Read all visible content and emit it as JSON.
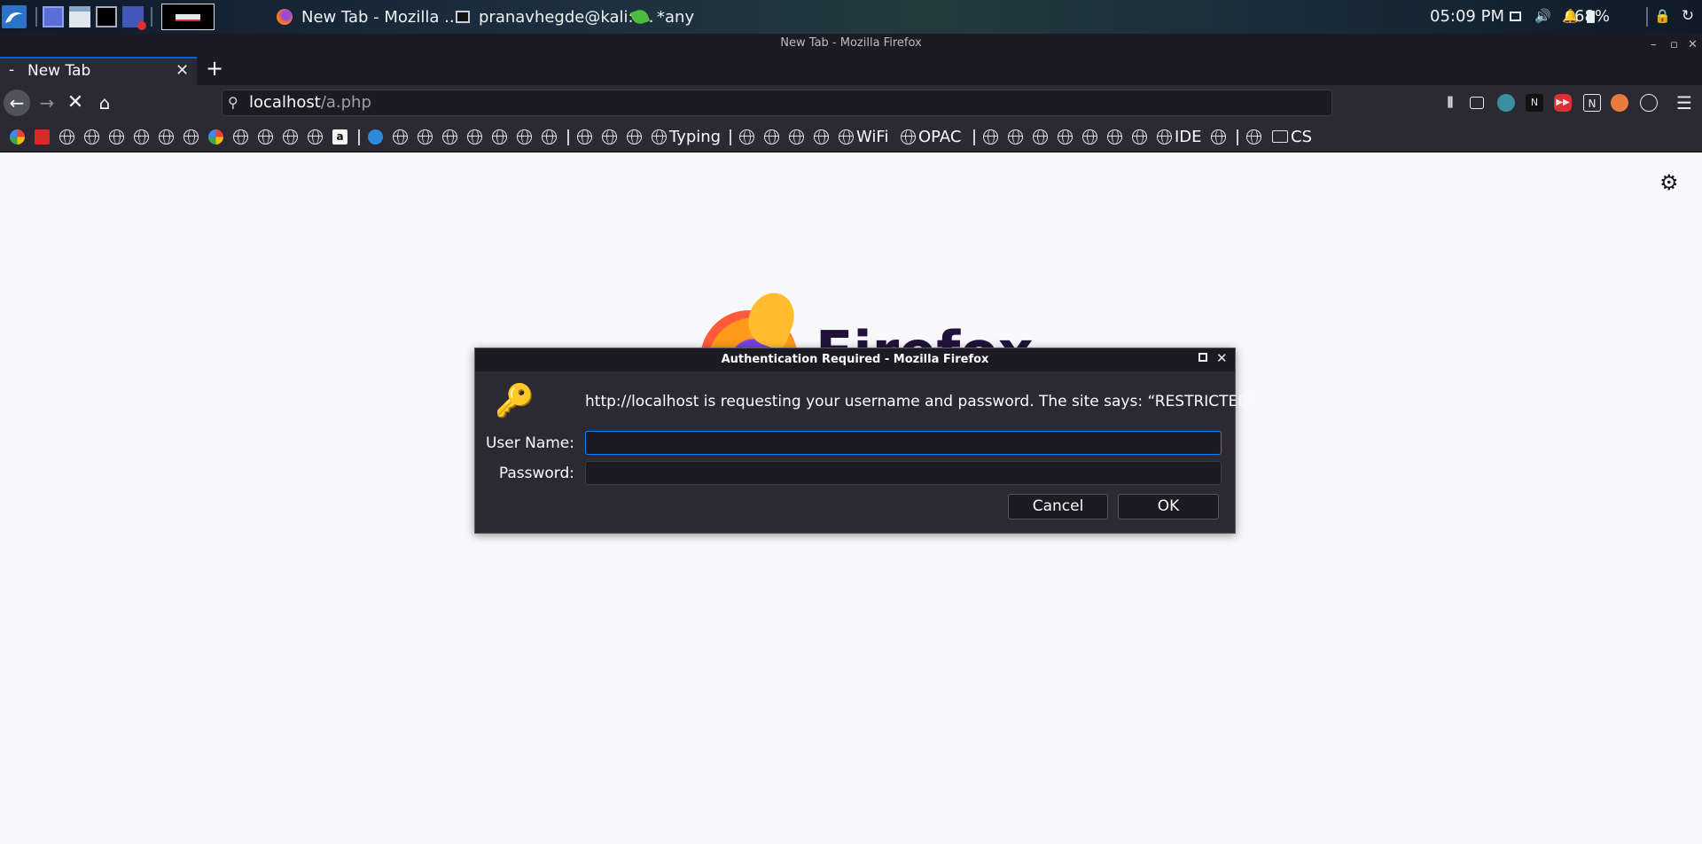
{
  "panel": {
    "tasks": [
      {
        "label": "New Tab - Mozilla ..."
      },
      {
        "label": "pranavhegde@kali: ..."
      },
      {
        "label": "*any"
      }
    ],
    "clock": "05:09 PM",
    "battery": "68%"
  },
  "window": {
    "title": "New Tab - Mozilla Firefox"
  },
  "tabs": [
    {
      "label": "New Tab"
    }
  ],
  "urlbar": {
    "host": "localhost",
    "path": "/a.php"
  },
  "bookmarks": {
    "labeled": [
      "Typing",
      "WiFi",
      "OPAC",
      "IDE",
      "CS"
    ]
  },
  "page": {
    "logo_text": "Firefox"
  },
  "dialog": {
    "title": "Authentication Required - Mozilla Firefox",
    "message": "http://localhost is requesting your username and password. The site says: “RESTRICTED”",
    "username_label": "User Name:",
    "password_label": "Password:",
    "username_value": "",
    "password_value": "",
    "cancel_label": "Cancel",
    "ok_label": "OK"
  },
  "colors": {
    "accent": "#0a84ff",
    "toolbar": "#2b2a33",
    "content_bg": "#f9f9fb"
  }
}
